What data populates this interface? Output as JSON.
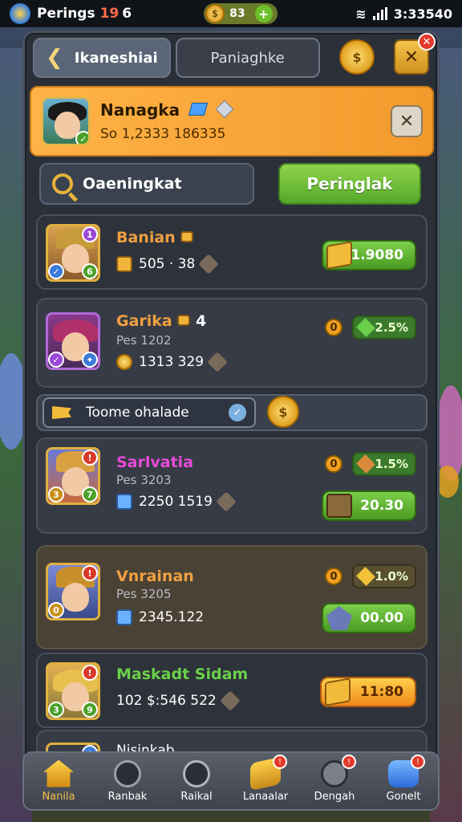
{
  "status_bar": {
    "app_title": "Perings",
    "title_number": "19",
    "title_suffix": "6",
    "coin_value": "83",
    "time": "3:33540"
  },
  "tabs": [
    {
      "label": "Ikaneshiai"
    },
    {
      "label": "Paniaghke"
    }
  ],
  "profile": {
    "name": "Nanagka",
    "stats": "So 1,2333 186335"
  },
  "actions": {
    "search_label": "Oaeningkat",
    "primary_label": "Peringlak"
  },
  "filter": {
    "label": "Toome ohalade"
  },
  "rows": [
    {
      "name": "Banian",
      "sub": "",
      "stat": "505 · 38",
      "pct": "",
      "value": "1.9080"
    },
    {
      "name": "Garika",
      "name_suffix": "4",
      "sub": "Pes 1202",
      "stat": "1313 329",
      "pct": "2.5%",
      "value": ""
    },
    {
      "name": "Sarlvatia",
      "sub": "Pes 3203",
      "stat": "2250 1519",
      "pct": "1.5%",
      "value": "20.30"
    },
    {
      "name": "Vnrainan",
      "sub": "Pes 3205",
      "stat": "2345.122",
      "pct": "1.0%",
      "value": "00.00"
    },
    {
      "name": "Maskadt Sidam",
      "sub": "",
      "stat": "102 $:546 522",
      "pct": "",
      "value": "11:80"
    },
    {
      "name": "Nisinkab",
      "sub": "",
      "stat": "",
      "pct": "",
      "value": ""
    }
  ],
  "bottom_nav": [
    {
      "label": "Nanila"
    },
    {
      "label": "Ranbak"
    },
    {
      "label": "Raikal"
    },
    {
      "label": "Lanaalar"
    },
    {
      "label": "Dengah"
    },
    {
      "label": "Gonelt"
    }
  ],
  "colors": {
    "accent_orange": "#f39a2c",
    "accent_green": "#55a82a",
    "panel_bg": "#2b2f38"
  }
}
